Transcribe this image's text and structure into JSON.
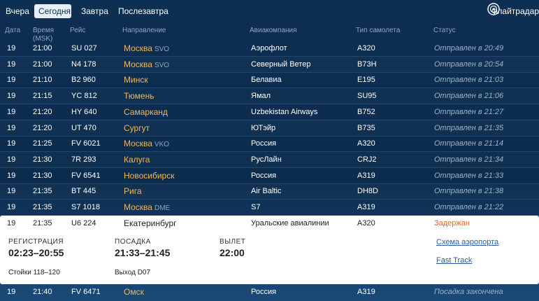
{
  "topbar": {
    "tabs": [
      {
        "label": "Вчера",
        "active": false
      },
      {
        "label": "Сегодня",
        "active": true
      },
      {
        "label": "Завтра",
        "active": false
      },
      {
        "label": "Послезавтра",
        "active": false
      }
    ],
    "flightradar_label": "Флайтрадар",
    "flightradar_icon": "radar-icon"
  },
  "columns": {
    "date": "Дата",
    "time_line1": "Время",
    "time_line2": "(MSK)",
    "flight": "Рейс",
    "destination": "Направление",
    "airline": "Авиакомпания",
    "aircraft": "Тип самолета",
    "status": "Статус"
  },
  "flights": [
    {
      "date": "19",
      "time": "21:00",
      "flight": "SU 027",
      "city": "Москва",
      "airport": "SVO",
      "airline": "Аэрофлот",
      "aircraft": "A320",
      "status": "Отправлен в 20:49"
    },
    {
      "date": "19",
      "time": "21:00",
      "flight": "N4 178",
      "city": "Москва",
      "airport": "SVO",
      "airline": "Северный Ветер",
      "aircraft": "B73H",
      "status": "Отправлен в 20:54"
    },
    {
      "date": "19",
      "time": "21:10",
      "flight": "B2 960",
      "city": "Минск",
      "airport": "",
      "airline": "Белавиа",
      "aircraft": "E195",
      "status": "Отправлен в 21:03"
    },
    {
      "date": "19",
      "time": "21:15",
      "flight": "YC 812",
      "city": "Тюмень",
      "airport": "",
      "airline": "Ямал",
      "aircraft": "SU95",
      "status": "Отправлен в 21:06"
    },
    {
      "date": "19",
      "time": "21:20",
      "flight": "HY 640",
      "city": "Самарканд",
      "airport": "",
      "airline": "Uzbekistan Airways",
      "aircraft": "B752",
      "status": "Отправлен в 21:27"
    },
    {
      "date": "19",
      "time": "21:20",
      "flight": "UT 470",
      "city": "Сургут",
      "airport": "",
      "airline": "ЮТэйр",
      "aircraft": "B735",
      "status": "Отправлен в 21:35"
    },
    {
      "date": "19",
      "time": "21:25",
      "flight": "FV 6021",
      "city": "Москва",
      "airport": "VKO",
      "airline": "Россия",
      "aircraft": "A320",
      "status": "Отправлен в 21:14"
    },
    {
      "date": "19",
      "time": "21:30",
      "flight": "7R 293",
      "city": "Калуга",
      "airport": "",
      "airline": "РусЛайн",
      "aircraft": "CRJ2",
      "status": "Отправлен в 21:34"
    },
    {
      "date": "19",
      "time": "21:30",
      "flight": "FV 6541",
      "city": "Новосибирск",
      "airport": "",
      "airline": "Россия",
      "aircraft": "A319",
      "status": "Отправлен в 21:33"
    },
    {
      "date": "19",
      "time": "21:35",
      "flight": "BT 445",
      "city": "Рига",
      "airport": "",
      "airline": "Air Baltic",
      "aircraft": "DH8D",
      "status": "Отправлен в 21:38"
    },
    {
      "date": "19",
      "time": "21:35",
      "flight": "S7 1018",
      "city": "Москва",
      "airport": "DME",
      "airline": "S7",
      "aircraft": "A319",
      "status": "Отправлен в 21:22"
    }
  ],
  "expanded": {
    "date": "19",
    "time": "21:35",
    "flight": "U6 224",
    "city": "Екатеринбург",
    "airline": "Уральские авиалинии",
    "aircraft": "A320",
    "status": "Задержан",
    "checkin_label": "РЕГИСТРАЦИЯ",
    "checkin_value": "02:23–20:55",
    "checkin_sub": "Стойки 118–120",
    "boarding_label": "ПОСАДКА",
    "boarding_value": "21:33–21:45",
    "boarding_sub": "Выход D07",
    "departure_label": "ВЫЛЕТ",
    "departure_value": "22:00",
    "link_map": "Схема аэропорта",
    "link_fasttrack": "Fast Track"
  },
  "last_row": {
    "date": "19",
    "time": "21:40",
    "flight": "FV 6471",
    "city": "Омск",
    "airline": "Россия",
    "aircraft": "A319",
    "status": "Посадка закончена"
  }
}
